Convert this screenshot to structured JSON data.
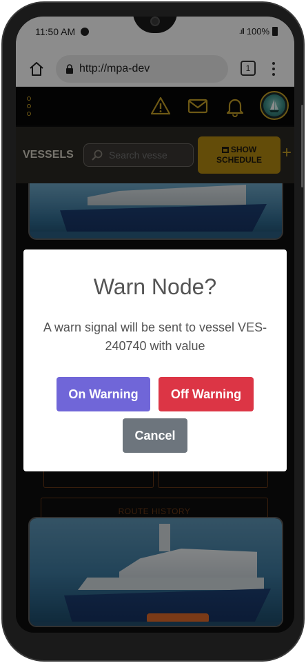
{
  "status_bar": {
    "time": "11:50 AM",
    "signal": ".ıll",
    "battery": "100%"
  },
  "browser": {
    "url": "http://mpa-dev",
    "tab_count": "1"
  },
  "app_header": {
    "icons": [
      "menu-dots-icon",
      "warning-icon",
      "mail-icon",
      "bell-icon",
      "vessel-avatar-icon"
    ],
    "accent_color": "#c9a227"
  },
  "vessels_bar": {
    "label": "VESSELS",
    "search_placeholder": "Search vesse",
    "show_schedule_label_1": "SHOW",
    "show_schedule_label_2": "SCHEDULE",
    "add_label": "+"
  },
  "vessel_card": {
    "route_history_label": "ROUTE HISTORY"
  },
  "modal": {
    "title": "Warn Node?",
    "message": "A warn signal will be sent to vessel VES-240740 with value",
    "on_warning_label": "On Warning",
    "off_warning_label": "Off Warning",
    "cancel_label": "Cancel",
    "colors": {
      "on_warning": "#7066d8",
      "off_warning": "#dc3545",
      "cancel": "#6d757d"
    }
  }
}
